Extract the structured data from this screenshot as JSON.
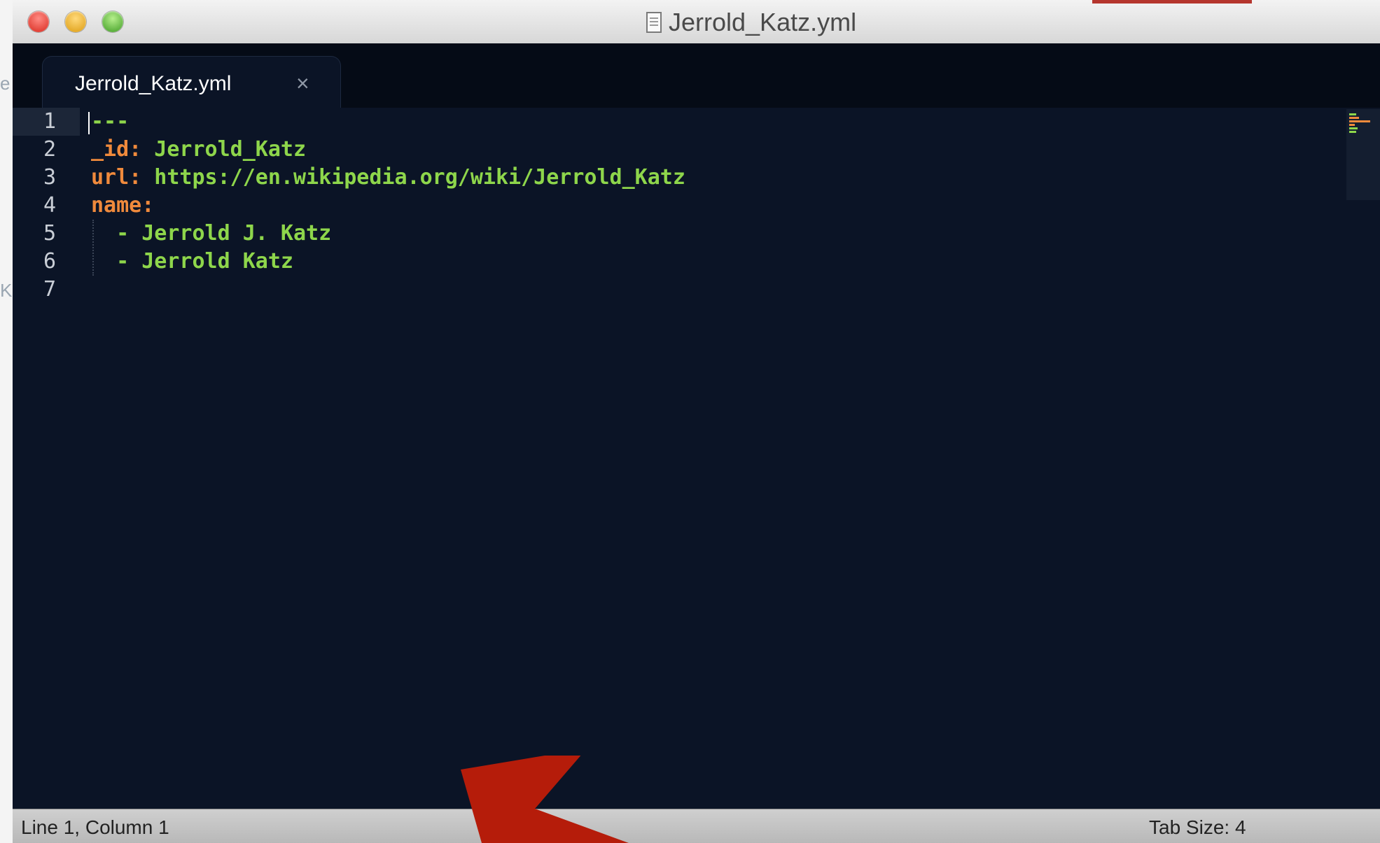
{
  "window": {
    "title": "Jerrold_Katz.yml"
  },
  "tabs": [
    {
      "label": "Jerrold_Katz.yml",
      "close": "×",
      "active": true
    }
  ],
  "editor": {
    "line_numbers": [
      "1",
      "2",
      "3",
      "4",
      "5",
      "6",
      "7"
    ],
    "current_line": 1,
    "lines": [
      [
        {
          "t": "---",
          "c": "s"
        }
      ],
      [
        {
          "t": "_id:",
          "c": "k"
        },
        {
          "t": " Jerrold_Katz",
          "c": "s"
        }
      ],
      [
        {
          "t": "url:",
          "c": "k"
        },
        {
          "t": " https://en.wikipedia.org/wiki/Jerrold_Katz",
          "c": "s"
        }
      ],
      [
        {
          "t": "name:",
          "c": "k"
        }
      ],
      [
        {
          "t": "  - Jerrold J. Katz",
          "c": "s"
        }
      ],
      [
        {
          "t": "  - Jerrold Katz",
          "c": "s"
        }
      ],
      []
    ]
  },
  "status": {
    "position": "Line 1, Column 1",
    "tab_size": "Tab Size: 4"
  },
  "desktop_fragments": [
    "e",
    "K"
  ],
  "colors": {
    "background": "#0b1426",
    "key": "#f08a3c",
    "string": "#8ed64b",
    "arrow": "#b51c0a"
  }
}
